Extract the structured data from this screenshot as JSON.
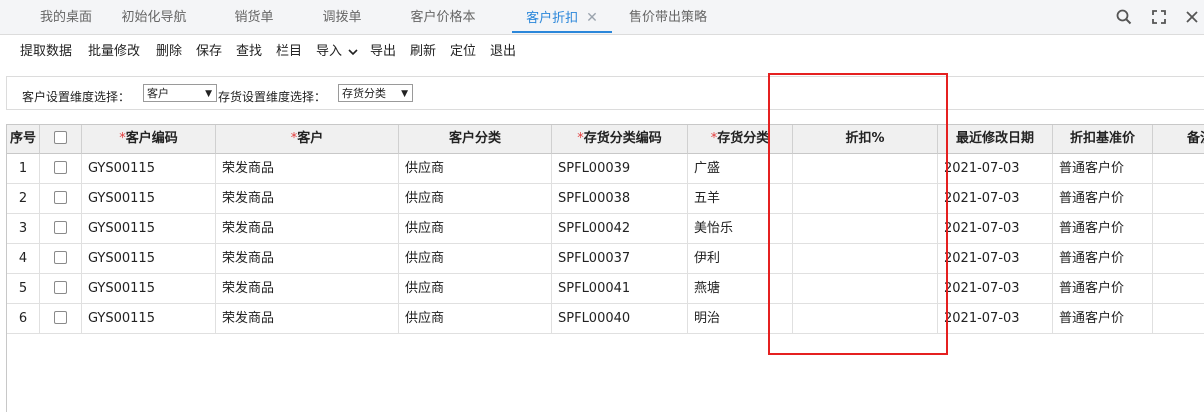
{
  "tabs": [
    {
      "label": "我的桌面"
    },
    {
      "label": "初始化导航"
    },
    {
      "label": "销货单"
    },
    {
      "label": "调拨单"
    },
    {
      "label": "客户价格本"
    },
    {
      "label": "客户折扣",
      "active": true,
      "close": "✕"
    },
    {
      "label": "售价带出策略"
    }
  ],
  "window_icons": [
    "search-icon",
    "fullscreen-icon",
    "close-icon"
  ],
  "toolbar": {
    "fetch": "提取数据",
    "batch_edit": "批量修改",
    "delete": "删除",
    "save": "保存",
    "find": "查找",
    "columns": "栏目",
    "import": "导入",
    "export": "导出",
    "refresh": "刷新",
    "locate": "定位",
    "exit": "退出"
  },
  "filter": {
    "customer_dim_label": "客户设置维度选择：",
    "customer_dim_value": "客户",
    "stock_dim_label": "存货设置维度选择：",
    "stock_dim_value": "存货分类"
  },
  "table": {
    "headers": {
      "seq": "序号",
      "customer_code": "客户编码",
      "customer": "客户",
      "customer_category": "客户分类",
      "stock_category_code": "存货分类编码",
      "stock_category": "存货分类",
      "discount": "折扣%",
      "last_modified": "最近修改日期",
      "base_price": "折扣基准价",
      "remark": "备注"
    },
    "required_mark": "*",
    "rows": [
      {
        "seq": "1",
        "customer_code": "GYS00115",
        "customer": "荣发商品",
        "customer_category": "供应商",
        "stock_category_code": "SPFL00039",
        "stock_category": "广盛",
        "discount": "",
        "last_modified": "2021-07-03",
        "base_price": "普通客户价",
        "remark": ""
      },
      {
        "seq": "2",
        "customer_code": "GYS00115",
        "customer": "荣发商品",
        "customer_category": "供应商",
        "stock_category_code": "SPFL00038",
        "stock_category": "五羊",
        "discount": "",
        "last_modified": "2021-07-03",
        "base_price": "普通客户价",
        "remark": ""
      },
      {
        "seq": "3",
        "customer_code": "GYS00115",
        "customer": "荣发商品",
        "customer_category": "供应商",
        "stock_category_code": "SPFL00042",
        "stock_category": "美怡乐",
        "discount": "",
        "last_modified": "2021-07-03",
        "base_price": "普通客户价",
        "remark": ""
      },
      {
        "seq": "4",
        "customer_code": "GYS00115",
        "customer": "荣发商品",
        "customer_category": "供应商",
        "stock_category_code": "SPFL00037",
        "stock_category": "伊利",
        "discount": "",
        "last_modified": "2021-07-03",
        "base_price": "普通客户价",
        "remark": ""
      },
      {
        "seq": "5",
        "customer_code": "GYS00115",
        "customer": "荣发商品",
        "customer_category": "供应商",
        "stock_category_code": "SPFL00041",
        "stock_category": "燕塘",
        "discount": "",
        "last_modified": "2021-07-03",
        "base_price": "普通客户价",
        "remark": ""
      },
      {
        "seq": "6",
        "customer_code": "GYS00115",
        "customer": "荣发商品",
        "customer_category": "供应商",
        "stock_category_code": "SPFL00040",
        "stock_category": "明治",
        "discount": "",
        "last_modified": "2021-07-03",
        "base_price": "普通客户价",
        "remark": ""
      }
    ]
  },
  "colors": {
    "accent": "#2b87da",
    "required": "#e23b3b",
    "highlight": "#e52020"
  }
}
